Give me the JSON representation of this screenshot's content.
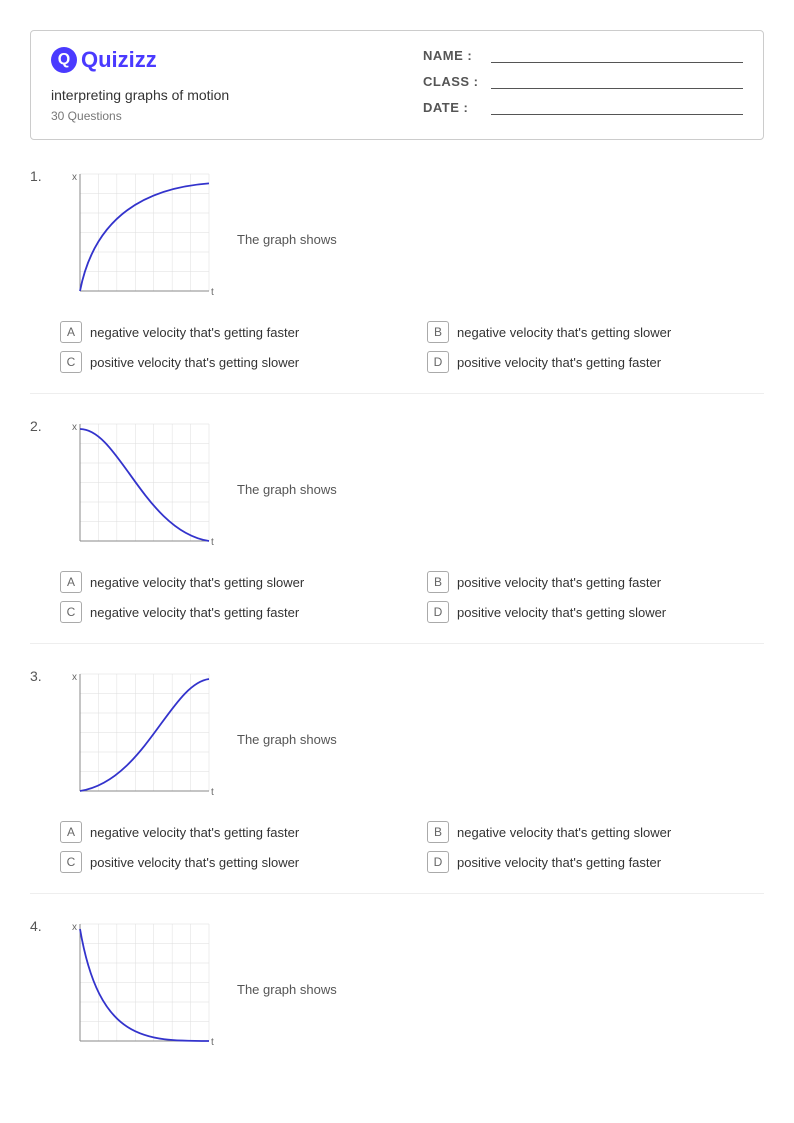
{
  "header": {
    "logo_text": "Quizizz",
    "quiz_title": "interpreting graphs of motion",
    "quiz_subtitle": "30 Questions",
    "fields": {
      "name_label": "NAME :",
      "class_label": "CLASS :",
      "date_label": "DATE :"
    }
  },
  "questions": [
    {
      "number": "1.",
      "graph_label": "The graph shows",
      "options": [
        {
          "letter": "A",
          "text": "negative velocity that's getting faster"
        },
        {
          "letter": "B",
          "text": "negative velocity that's getting slower"
        },
        {
          "letter": "C",
          "text": "positive velocity that's getting slower"
        },
        {
          "letter": "D",
          "text": "positive velocity that's getting faster"
        }
      ],
      "curve_type": "pos_concave_down"
    },
    {
      "number": "2.",
      "graph_label": "The graph shows",
      "options": [
        {
          "letter": "A",
          "text": "negative velocity that's getting slower"
        },
        {
          "letter": "B",
          "text": "positive velocity that's getting faster"
        },
        {
          "letter": "C",
          "text": "negative velocity that's getting faster"
        },
        {
          "letter": "D",
          "text": "positive velocity that's getting slower"
        }
      ],
      "curve_type": "neg_concave_up"
    },
    {
      "number": "3.",
      "graph_label": "The graph shows",
      "options": [
        {
          "letter": "A",
          "text": "negative velocity that's getting faster"
        },
        {
          "letter": "B",
          "text": "negative velocity that's getting slower"
        },
        {
          "letter": "C",
          "text": "positive velocity that's getting slower"
        },
        {
          "letter": "D",
          "text": "positive velocity that's getting faster"
        }
      ],
      "curve_type": "pos_concave_up"
    },
    {
      "number": "4.",
      "graph_label": "The graph shows",
      "options": [],
      "curve_type": "neg_concave_down"
    }
  ]
}
